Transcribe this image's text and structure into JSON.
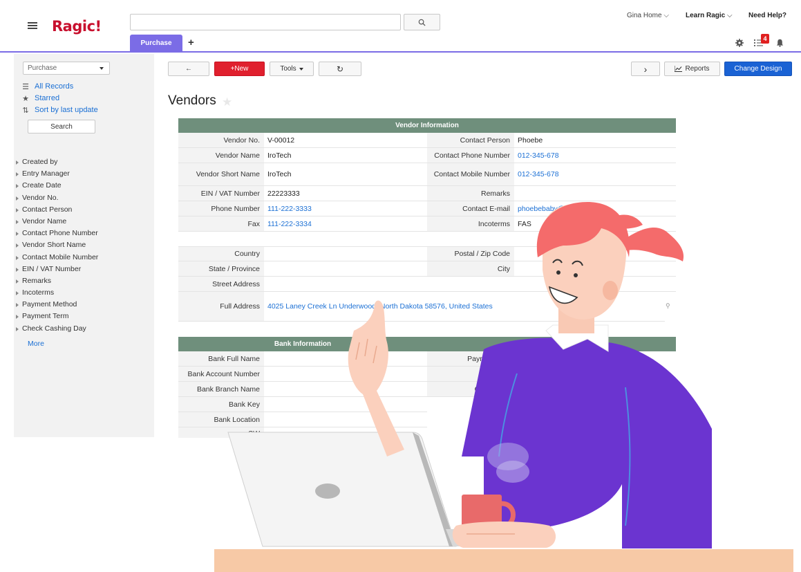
{
  "app": {
    "logo": "Ragic!",
    "tab_active": "Purchase",
    "tab_add": "+"
  },
  "header_nav": {
    "user": "Gina Home",
    "learn": "Learn Ragic",
    "help": "Need Help?",
    "task_badge": "4"
  },
  "sidebar": {
    "select_value": "Purchase",
    "all_records": "All Records",
    "starred": "Starred",
    "sort": "Sort by last update",
    "search_btn": "Search",
    "fields": [
      "Created by",
      "Entry Manager",
      "Create Date",
      "Vendor No.",
      "Contact Person",
      "Vendor Name",
      "Contact Phone Number",
      "Vendor Short Name",
      "Contact Mobile Number",
      "EIN / VAT Number",
      "Remarks",
      "Incoterms",
      "Payment Method",
      "Payment Term",
      "Check Cashing Day"
    ],
    "more": "More"
  },
  "toolbar": {
    "back": "←",
    "new": "+New",
    "tools": "Tools",
    "refresh": "↻",
    "next": "›",
    "reports": "Reports",
    "change_design": "Change Design"
  },
  "page_title": "Vendors",
  "vendor_info": {
    "header": "Vendor Information",
    "rows": [
      {
        "l1": "Vendor No.",
        "v1": "V-00012",
        "l2": "Contact Person",
        "v2": "Phoebe"
      },
      {
        "l1": "Vendor Name",
        "v1": "IroTech",
        "l2": "Contact Phone Number",
        "v2": "012-345-678"
      },
      {
        "l1": "Vendor Short Name",
        "v1": "IroTech",
        "l2": "Contact Mobile Number",
        "v2": "012-345-678"
      },
      {
        "l1": "EIN / VAT Number",
        "v1": "22223333",
        "l2": "Remarks",
        "v2": ""
      },
      {
        "l1": "Phone Number",
        "v1": "111-222-3333",
        "l2": "Contact E-mail",
        "v2": "phoebebaby@sample.com"
      },
      {
        "l1": "Fax",
        "v1": "111-222-3334",
        "l2": "Incoterms",
        "v2": "FAS"
      }
    ]
  },
  "address": {
    "country": "Country",
    "postal": "Postal / Zip Code",
    "state": "State / Province",
    "city": "City",
    "street": "Street Address",
    "full": "Full Address",
    "full_value": "4025 Laney Creek Ln Underwood, North Dakota 58576, United States"
  },
  "bank_info": {
    "header": "Bank Information",
    "rows": [
      "Bank Full Name",
      "Bank Account Number",
      "Bank Branch Name",
      "Bank Key",
      "Bank Location",
      "SW"
    ],
    "right_rows": [
      "Payment Met",
      "Paymen",
      "Check Cas"
    ]
  },
  "colors": {
    "accent": "#7b6ce6",
    "brand_red": "#c8102e",
    "section_green": "#6f8f7c",
    "link_blue": "#1a6fd4",
    "change_design_blue": "#1a62d4"
  }
}
